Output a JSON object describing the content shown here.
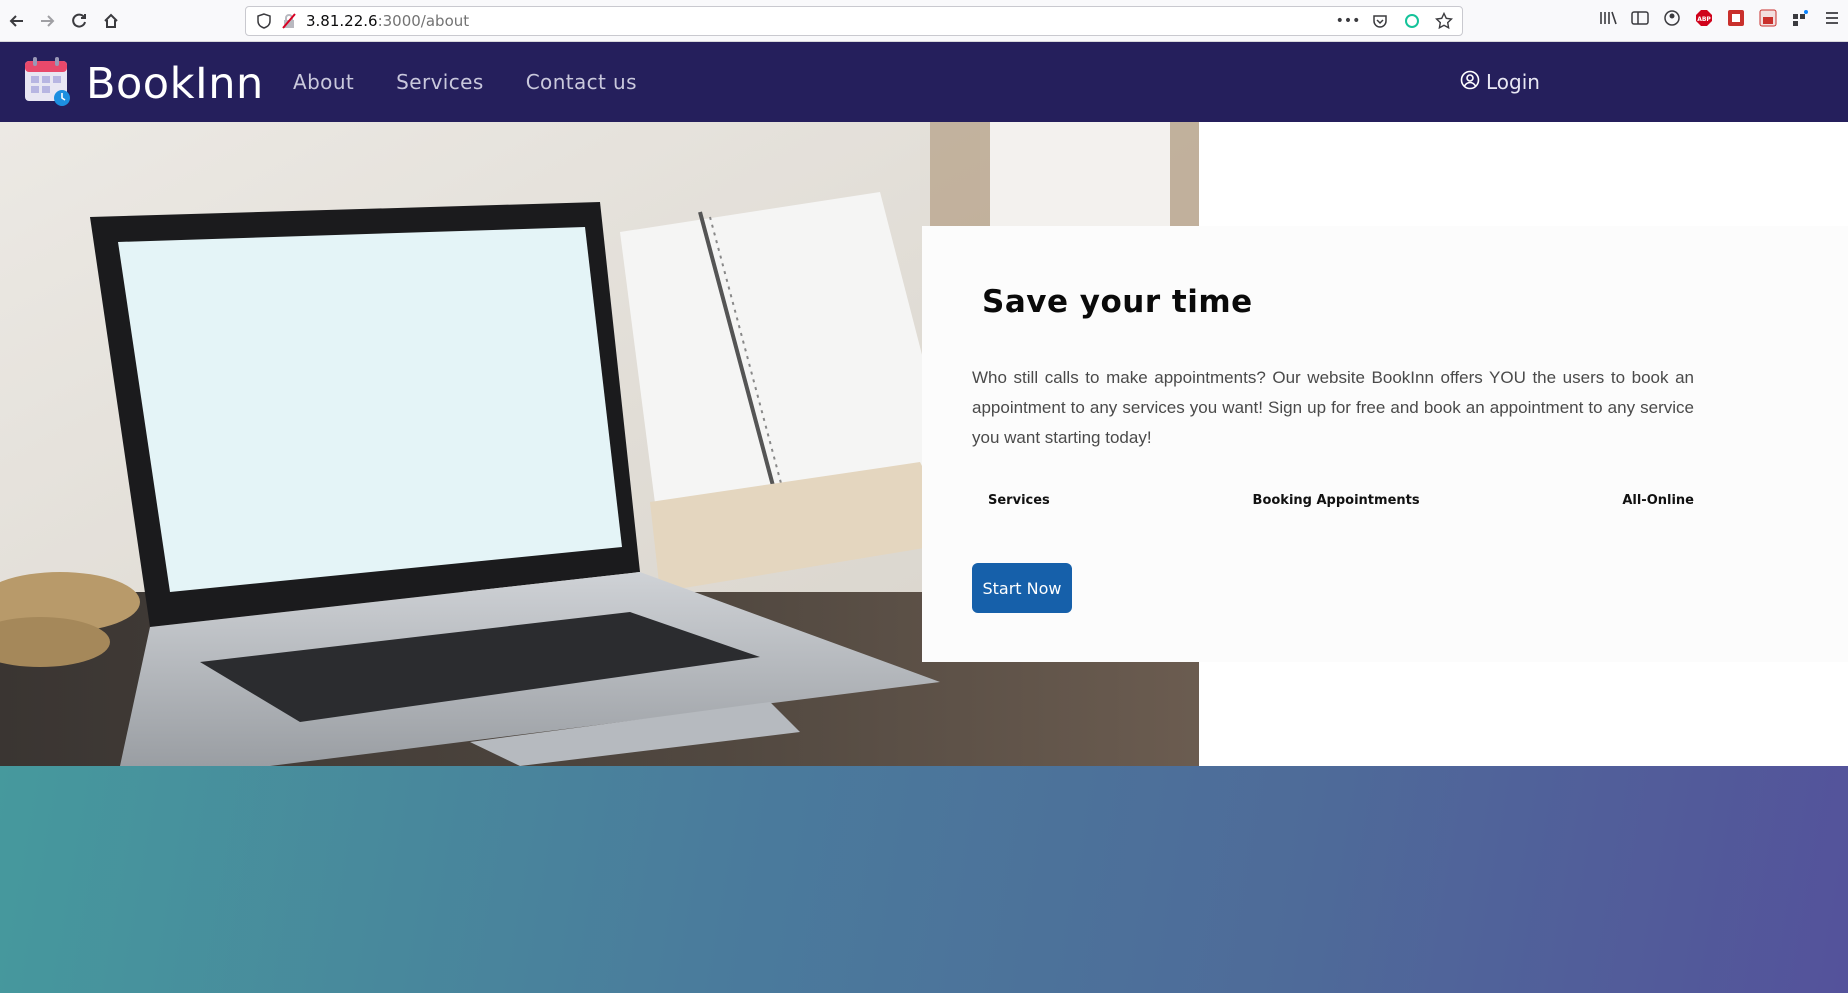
{
  "browser": {
    "url_host": "3.81.22.6",
    "url_path": ":3000/about"
  },
  "nav": {
    "brand": "BookInn",
    "links": [
      "About",
      "Services",
      "Contact us"
    ],
    "login": "Login"
  },
  "hero": {
    "title": "Save your time",
    "text": "Who still calls to make appointments? Our website BookInn offers YOU the users to book an appointment to any services you want! Sign up for free and book an appointment to any service you want starting today!",
    "features": [
      "Services",
      "Booking Appointments",
      "All-Online"
    ],
    "cta": "Start Now"
  },
  "colors": {
    "nav_bg": "#251f5c",
    "cta_bg": "#1660aa",
    "gradient_start": "#46999d",
    "gradient_end": "#54529b"
  }
}
